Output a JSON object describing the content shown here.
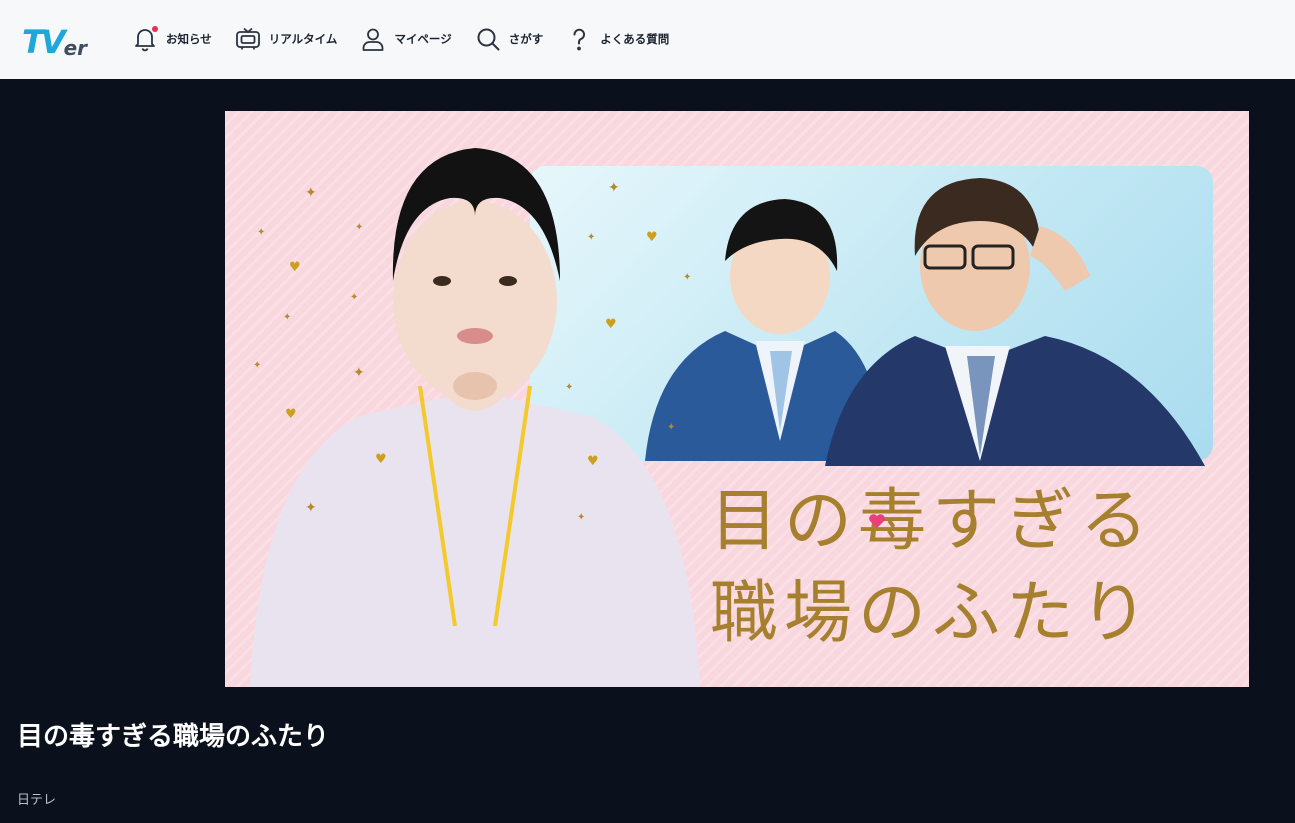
{
  "app": {
    "logo_text_main": "TV",
    "logo_text_sub": "er"
  },
  "nav": {
    "items": [
      {
        "label": "お知らせ",
        "icon": "bell-icon",
        "has_badge": true
      },
      {
        "label": "リアルタイム",
        "icon": "tv-icon"
      },
      {
        "label": "マイページ",
        "icon": "user-icon"
      },
      {
        "label": "さがす",
        "icon": "search-icon"
      },
      {
        "label": "よくある質問",
        "icon": "question-icon"
      }
    ]
  },
  "hero": {
    "title_line1": "目の毒すぎる",
    "title_line2": "職場のふたり",
    "background_color": "#f9d7de",
    "title_color": "#a6802e"
  },
  "program": {
    "title": "目の毒すぎる職場のふたり",
    "broadcaster": "日テレ"
  },
  "colors": {
    "header_bg": "#f7f8fa",
    "page_bg": "#0a111c",
    "logo_blue": "#1fa7d9",
    "badge_red": "#e8304a"
  }
}
